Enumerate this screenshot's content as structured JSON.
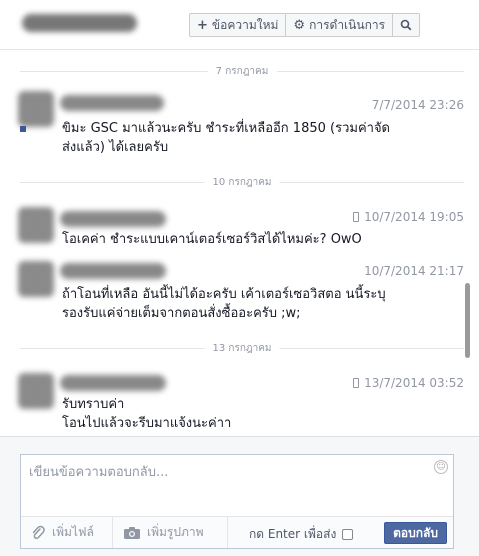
{
  "header": {
    "new_message_label": "ข้อความใหม่",
    "actions_label": "การดำเนินการ",
    "new_message_icon": "plus-icon",
    "actions_icon": "gear-icon",
    "search_icon": "search-icon"
  },
  "conversation": {
    "date_separators": [
      "7 กรกฎาคม",
      "10 กรกฎาคม",
      "13 กรกฎาคม"
    ],
    "messages": [
      {
        "time": "7/7/2014 23:26",
        "mobile": false,
        "lines": [
          "ขิมะ GSC มาแล้วนะครับ ชำระที่เหลืออีก 1850 (รวมค่าจัด",
          "ส่งแล้ว) ได้เลยครับ"
        ]
      },
      {
        "time": "10/7/2014 19:05",
        "mobile": true,
        "lines": [
          "โอเคค่า ชำระแบบเคาน์เตอร์เซอร์วิสได้ไหมค่ะ? OwO"
        ]
      },
      {
        "time": "10/7/2014 21:17",
        "mobile": false,
        "lines": [
          "ถ้าโอนที่เหลือ อันนี้ไม่ได้อะครับ เค้าเตอร์เซอวิสตอ นนี้ระบุ",
          "รองรับแค่จ่ายเต็มจากตอนสั่งซื้ออะครับ  ;w;"
        ]
      },
      {
        "time": "13/7/2014 03:52",
        "mobile": true,
        "lines": [
          "รับทราบค่า",
          "โอนไปแล้วจะรีบมาแจ้งนะค่าา"
        ]
      }
    ]
  },
  "composer": {
    "placeholder": "เขียนข้อความตอบกลับ...",
    "add_file_label": "เพิ่มไฟล์",
    "add_photo_label": "เพิ่มรูปภาพ",
    "enter_to_send_label": "กด Enter เพื่อส่ง",
    "reply_label": "ตอบกลับ",
    "add_file_icon": "paperclip-icon",
    "add_photo_icon": "camera-icon",
    "emoji_icon": "smiley-icon"
  },
  "colors": {
    "accent": "#4e69a2",
    "link_blue": "#3b5998",
    "muted_text": "#9197a3"
  }
}
